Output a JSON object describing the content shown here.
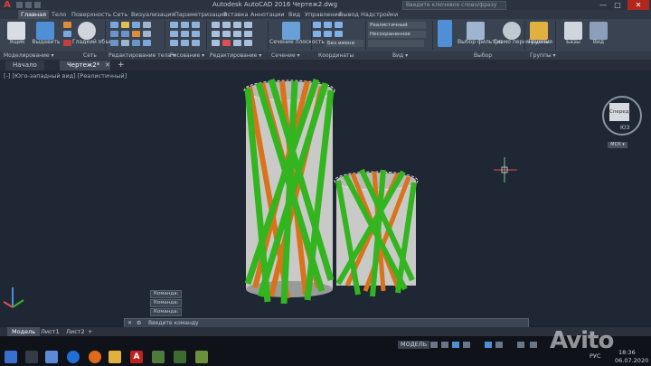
{
  "window": {
    "app_logo": "A",
    "title": "Autodesk AutoCAD 2016   Чертеж2.dwg",
    "search_placeholder": "Введите ключевое слово/фразу",
    "min": "—",
    "max": "□",
    "close": "✕"
  },
  "ribbon_tabs": [
    "Главная",
    "Тело",
    "Поверхность",
    "Сеть",
    "Визуализация",
    "Параметризация",
    "Вставка",
    "Аннотации",
    "Вид",
    "Управление",
    "Вывод",
    "Надстройки"
  ],
  "ribbon": {
    "big_tools": [
      {
        "label": "Ящик",
        "color": "#d8dde3"
      },
      {
        "label": "Выдавить",
        "color": "#4f8fd6"
      },
      {
        "label": "Гладкий объект",
        "color": "#cfd5dc"
      },
      {
        "label": "Сечение плоскость",
        "color": "#6aa0d8"
      },
      {
        "label": "Слои",
        "color": "#e0c050"
      },
      {
        "label": "Вид",
        "color": "#7fb0e6"
      },
      {
        "label": "Выбор фильтра",
        "color": "#9fb5cf"
      },
      {
        "label": "Гизмо перемещения",
        "color": "#c0c8d2"
      },
      {
        "label": "Группы",
        "color": "#e0b040"
      },
      {
        "label": "Базы",
        "color": "#cfd6de"
      },
      {
        "label": "Вид",
        "color": "#8aa0ba"
      }
    ],
    "layer_dropdown": "Несохраненное",
    "view_dropdown": "Без имени",
    "style_dropdown": "Реалистичный",
    "panel_labels": [
      "Моделирование ▾",
      "Сеть",
      "Редактирование тела ▾",
      "Рисование ▾",
      "Редактирование ▾",
      "Сечение ▾",
      "Координаты",
      "Вид ▾",
      "Выбор",
      "Группы ▾"
    ]
  },
  "doc_tabs": {
    "start": "Начало",
    "active": "Чертеж2*",
    "close": "✕",
    "add": "+"
  },
  "viewport": {
    "label": "[-] [Юго-западный вид] [Реалистичный]",
    "viewcube_face": "Спереди",
    "viewcube_bottom": "ЮЗ",
    "wcs": "МСК ▾"
  },
  "command": {
    "history": [
      "Команда:",
      "Команда:",
      "Команда:"
    ],
    "placeholder": "Введите команду"
  },
  "layout_tabs": [
    "Модель",
    "Лист1",
    "Лист2",
    "+"
  ],
  "status_bar": {
    "model": "МОДЕЛЬ",
    "lang": "РУС",
    "time": "18:36",
    "date": "06.07.2020"
  },
  "watermark": "Avito",
  "colors": {
    "green_rod": "#33b51f",
    "orange_rod": "#d9731b",
    "cylinder": "#c9c9c7",
    "background": "#1f2634"
  }
}
